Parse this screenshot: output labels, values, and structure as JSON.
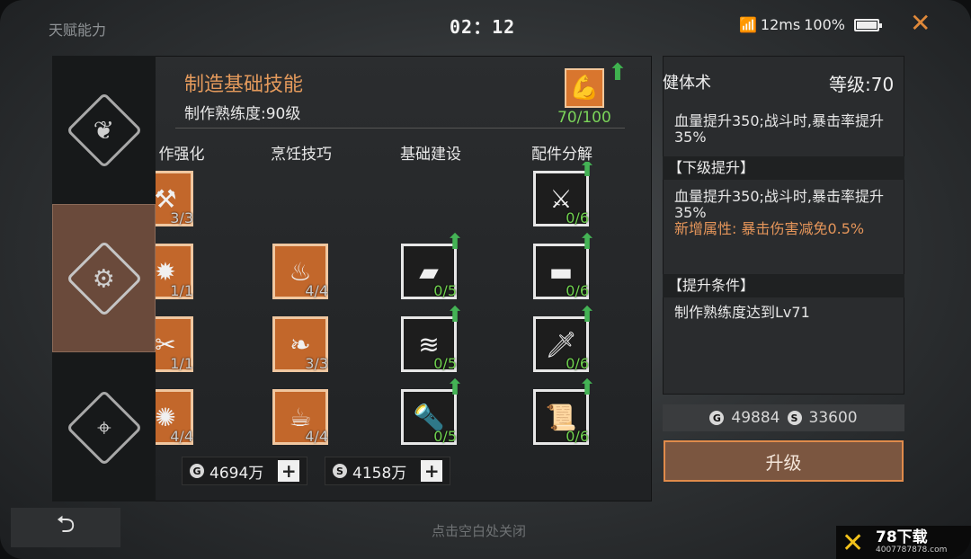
{
  "topbar": {
    "title": "天赋能力",
    "time": "02：12",
    "latency": "12ms",
    "battery": "100%",
    "battery_level": 1.0
  },
  "header": {
    "title": "制造基础技能",
    "proficiency": "制作熟练度:90级",
    "progress": "70/100"
  },
  "columns": [
    "作强化",
    "烹饪技巧",
    "基础建设",
    "配件分解"
  ],
  "skills": {
    "col0": [
      "3/3",
      "1/1",
      "1/1",
      "4/4"
    ],
    "col1": [
      "4/4",
      "3/3",
      "4/4"
    ],
    "col2": [
      "0/5",
      "0/5",
      "0/5"
    ],
    "col3": [
      "0/6",
      "0/6",
      "0/6",
      "0/6"
    ]
  },
  "currency": {
    "gold": "4694万",
    "silver": "4158万",
    "gold_symbol": "G",
    "silver_symbol": "S"
  },
  "info": {
    "name": "健体术",
    "level": "等级:70",
    "current_desc": "血量提升350;战斗时,暴击率提升35%",
    "next_header": "【下级提升】",
    "next_desc": "血量提升350;战斗时,暴击率提升35%",
    "new_attr": "新增属性: 暴击伤害减免0.5%",
    "cond_header": "【提升条件】",
    "cond_desc": "制作熟练度达到Lv71"
  },
  "cost": {
    "gold": "49884",
    "silver": "33600"
  },
  "upgrade_label": "升级",
  "close_hint": "点击空白处关闭",
  "watermark": {
    "title": "78下载",
    "url": "4007787878.com"
  },
  "colors": {
    "accent_orange": "#e49a5c",
    "progress_green": "#7bd45a",
    "active_tab": "#6a4a3b"
  }
}
